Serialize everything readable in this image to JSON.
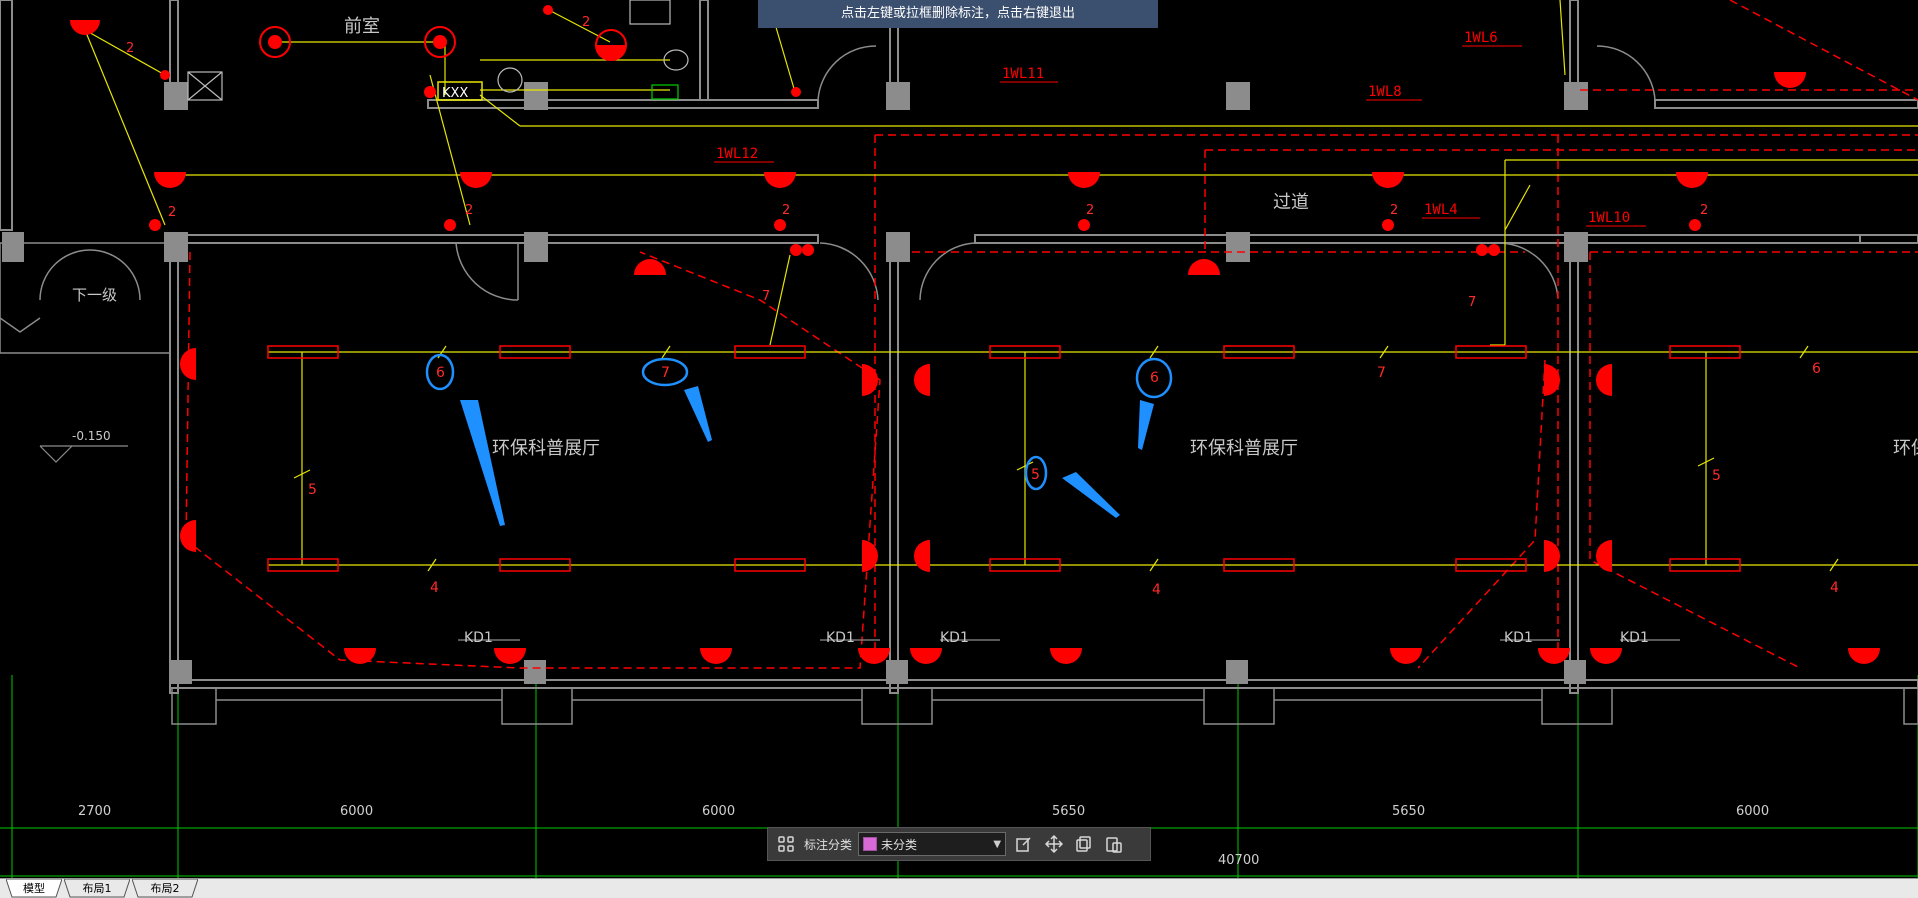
{
  "banner": {
    "message": "点击左键或拉框删除标注，点击右键退出"
  },
  "drawing": {
    "room_labels": [
      "前室",
      "过道",
      "环保科普展厅",
      "环保科普展厅",
      "环保科"
    ],
    "stair_label": "下一级",
    "level_label": "-0.150",
    "circuit_labels": [
      "1WL6",
      "1WL11",
      "1WL8",
      "1WL12",
      "1WL4",
      "1WL10"
    ],
    "panel_label": "KXX",
    "door_labels": [
      "KD1",
      "KD1",
      "KD1",
      "KD1",
      "KD1"
    ],
    "wire_counts_top": [
      "6",
      "7",
      "6",
      "7",
      "6"
    ],
    "wire_counts_side": [
      "5",
      "5",
      "5"
    ],
    "wire_counts_bottom": [
      "4",
      "4",
      "4"
    ],
    "small_counts": [
      "2",
      "2",
      "2",
      "2",
      "2",
      "2",
      "2",
      "2",
      "7",
      "7"
    ],
    "dimensions": [
      "2700",
      "6000",
      "6000",
      "5650",
      "5650",
      "6000"
    ],
    "total_dimension": "40700",
    "colors": {
      "wall": "#8c8c8c",
      "wire": "#e6e600",
      "fixture": "#ff0000",
      "markup": "#1e90ff",
      "grid": "#00c800"
    }
  },
  "annotation_toolbar": {
    "grid_icon": "grid-icon",
    "label": "标注分类",
    "category_value": "未分类",
    "icons": [
      "edit-icon",
      "move-icon",
      "copy-icon",
      "paste-icon"
    ]
  },
  "layout_tabs": [
    {
      "label": "模型",
      "active": true
    },
    {
      "label": "布局1",
      "active": false
    },
    {
      "label": "布局2",
      "active": false
    }
  ]
}
